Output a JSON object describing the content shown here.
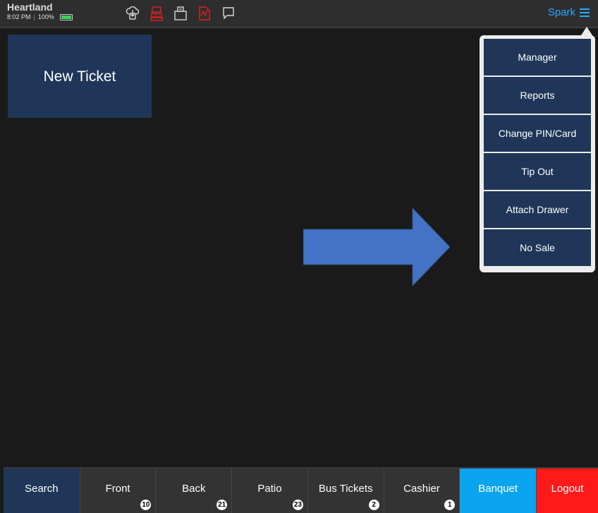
{
  "app": {
    "brand": "Heartland",
    "time": "8:02 PM",
    "battery": "100%"
  },
  "toolbar_icons": [
    "cloud-sync-icon",
    "register-icon",
    "printer-icon",
    "document-alert-icon",
    "chat-icon"
  ],
  "user": {
    "name": "Spark",
    "menu_icon": "hamburger-icon"
  },
  "new_ticket_label": "New Ticket",
  "menu": {
    "items": [
      "Manager",
      "Reports",
      "Change PIN/Card",
      "Tip Out",
      "Attach Drawer",
      "No Sale"
    ]
  },
  "bottom_tabs": [
    {
      "label": "Search",
      "badge": ""
    },
    {
      "label": "Front",
      "badge": "10"
    },
    {
      "label": "Back",
      "badge": "21"
    },
    {
      "label": "Patio",
      "badge": "23"
    },
    {
      "label": "Bus Tickets",
      "badge": "2"
    },
    {
      "label": "Cashier",
      "badge": "1"
    },
    {
      "label": "Banquet",
      "badge": ""
    },
    {
      "label": "Logout",
      "badge": ""
    }
  ],
  "colors": {
    "background": "#1a1a1a",
    "topbar": "#2e2e2e",
    "tile": "#1f3658",
    "accent": "#29a8ff",
    "arrow": "#4472c4",
    "banquet": "#0aa5ee",
    "logout": "#ff1a1a",
    "alert_icon": "#e02020"
  }
}
